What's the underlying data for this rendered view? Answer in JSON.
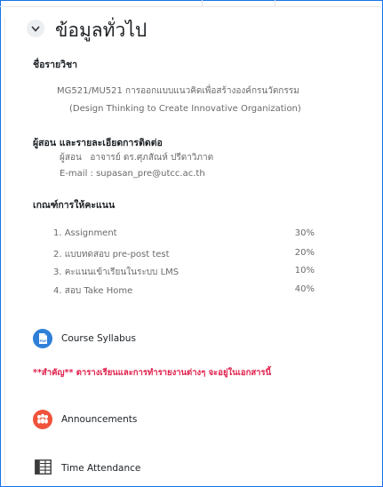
{
  "section": {
    "title": "ข้อมูลทั่วไป",
    "toggle_icon": "chevron-down-icon"
  },
  "course": {
    "heading": "ชื่อรายวิชา",
    "name_th": "MG521/MU521 การออกแบบแนวคิดเพื่อสร้างองค์กรนวัตกรรม",
    "name_en": "(Design Thinking to Create Innovative Organization)"
  },
  "instructor": {
    "heading": "ผู้สอน และรายละเอียดการติดต่อ",
    "line": "ผู้สอน   อาจารย์ ดร.ศุภสัณห์ ปรีดาวิภาต",
    "email": "E-mail : supasan_pre@utcc.ac.th"
  },
  "grading": {
    "heading": "เกณฑ์การให้คะแนน",
    "items": [
      {
        "name": "1. Assignment",
        "percent": "30%"
      },
      {
        "name": "2. แบบทดสอบ pre-post test",
        "percent": "20%"
      },
      {
        "name": "3. คะแนนเข้าเรียนในระบบ LMS",
        "percent": "10%"
      },
      {
        "name": "4. สอบ Take Home",
        "percent": "40%"
      }
    ]
  },
  "activities": {
    "syllabus": {
      "label": "Course Syllabus",
      "icon": "pdf-file-icon",
      "icon_text": "PDF",
      "color": "#2f7fd8"
    },
    "announcements": {
      "label": "Announcements",
      "icon": "forum-people-icon",
      "color": "#f0523b"
    },
    "attendance": {
      "label": "Time Attendance",
      "icon": "attendance-table-icon"
    }
  },
  "note": "**สำคัญ** ตารางเรียนและการทำรายงานต่างๆ จะอยู่ในเอกสารนี้"
}
